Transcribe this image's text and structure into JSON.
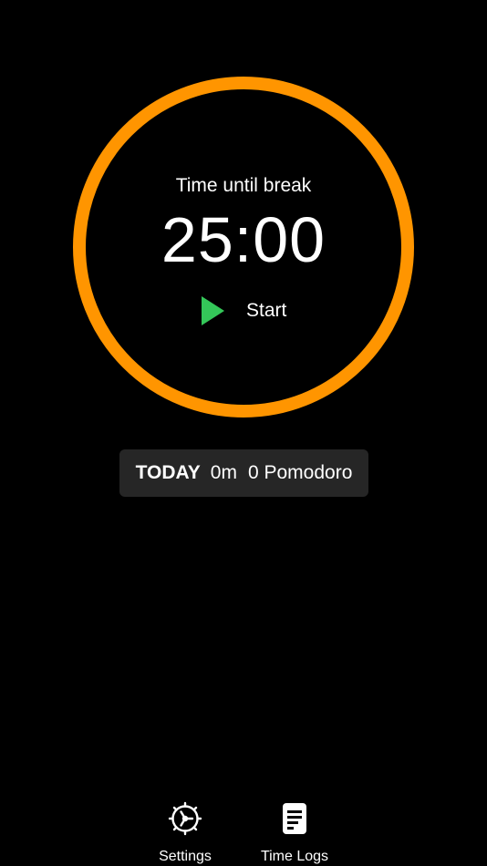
{
  "timer": {
    "caption": "Time until break",
    "time": "25:00",
    "ring_color": "#ff9500"
  },
  "start_button": {
    "label": "Start",
    "icon": "play-icon",
    "icon_color": "#34c759"
  },
  "today_summary": {
    "label": "TODAY",
    "minutes": "0m",
    "pomodoro": "0 Pomodoro"
  },
  "tab_bar": {
    "items": [
      {
        "label": "Settings",
        "icon": "gear-icon"
      },
      {
        "label": "Time Logs",
        "icon": "document-icon"
      }
    ]
  }
}
